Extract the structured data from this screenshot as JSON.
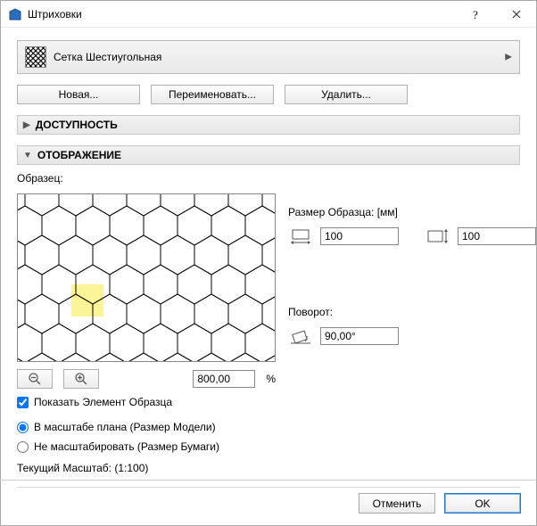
{
  "window": {
    "title": "Штриховки"
  },
  "fill": {
    "name": "Сетка Шестиугольная"
  },
  "buttons": {
    "new": "Новая...",
    "rename": "Переименовать...",
    "delete": "Удалить..."
  },
  "sections": {
    "availability": "ДОСТУПНОСТЬ",
    "display": "ОТОБРАЖЕНИЕ"
  },
  "preview": {
    "label": "Образец:",
    "zoom_value": "800,00",
    "zoom_suffix": "%"
  },
  "sample_size": {
    "label": "Размер Образца: [мм]",
    "width": "100",
    "height": "100"
  },
  "rotation": {
    "label": "Поворот:",
    "value": "90,00°"
  },
  "options": {
    "show_sample_element": "Показать Элемент Образца",
    "scale_plan": "В масштабе плана (Размер Модели)",
    "no_scale": "Не масштабировать (Размер Бумаги)"
  },
  "scale_note": "Текущий Масштаб: (1:100)",
  "footer": {
    "cancel": "Отменить",
    "ok": "OK"
  }
}
